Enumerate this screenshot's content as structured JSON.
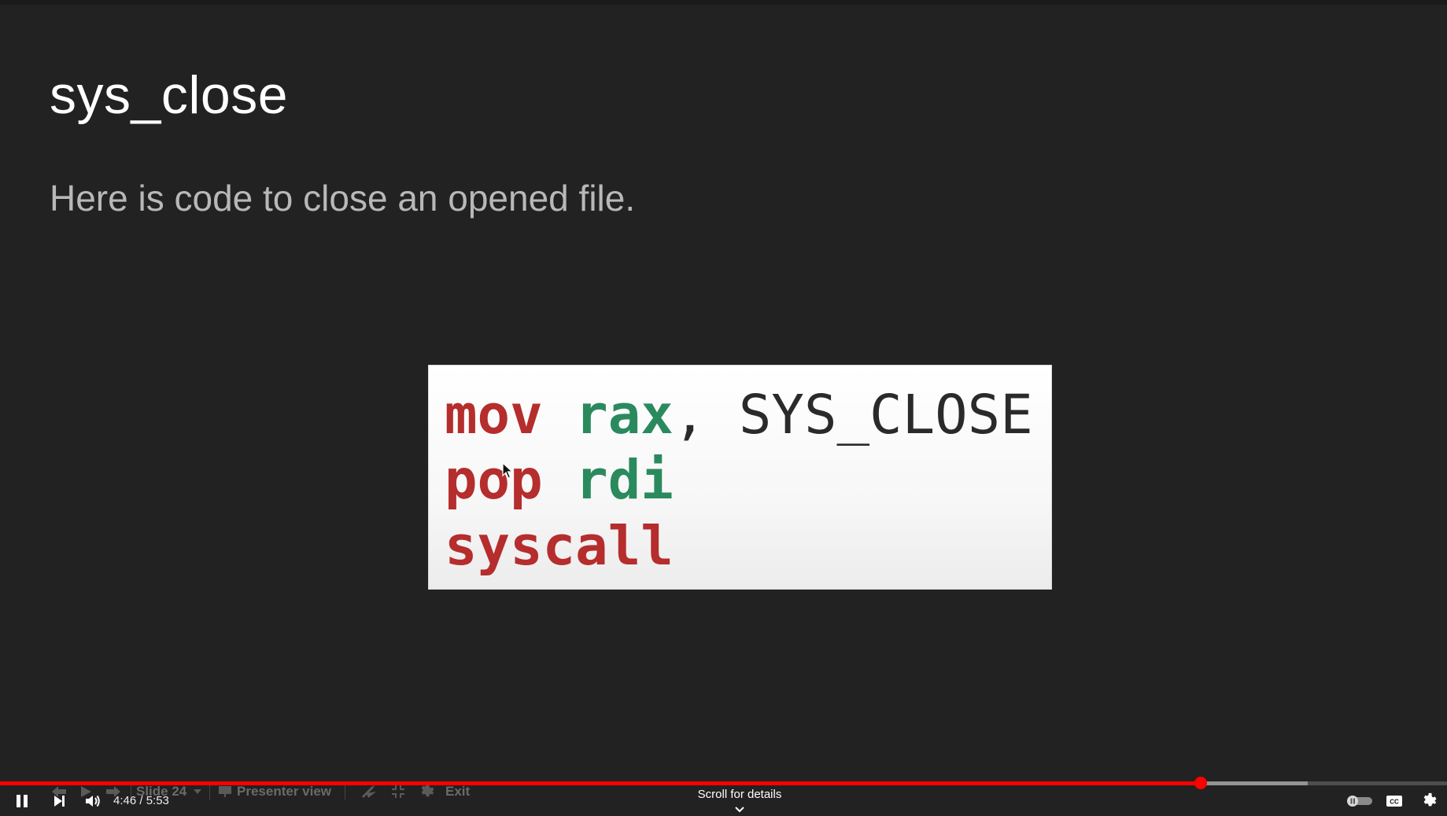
{
  "slide": {
    "title": "sys_close",
    "body": "Here is code to close an opened file.",
    "code": {
      "line1": {
        "keyword": "mov",
        "register": "rax",
        "sep": ",",
        "operand": "SYS_CLOSE"
      },
      "line2": {
        "keyword": "pop",
        "register": "rdi"
      },
      "line3": {
        "keyword": "syscall"
      }
    }
  },
  "presenter_toolbar": {
    "slide_label": "Slide 24",
    "presenter_view_label": "Presenter view",
    "exit_label": "Exit"
  },
  "player": {
    "current_time": "4:46",
    "duration": "5:53",
    "time_display": "4:46 / 5:53",
    "played_fraction": 0.83,
    "buffered_fraction": 0.904,
    "scroll_hint": "Scroll for details"
  },
  "colors": {
    "keyword": "#b52d2d",
    "register": "#2a8a5e",
    "progress": "#ff0000"
  },
  "icons": [
    "pause-icon",
    "next-icon",
    "volume-icon",
    "autoplay-toggle-icon",
    "captions-icon",
    "settings-icon",
    "chevron-down-icon",
    "mouse-cursor-icon"
  ]
}
